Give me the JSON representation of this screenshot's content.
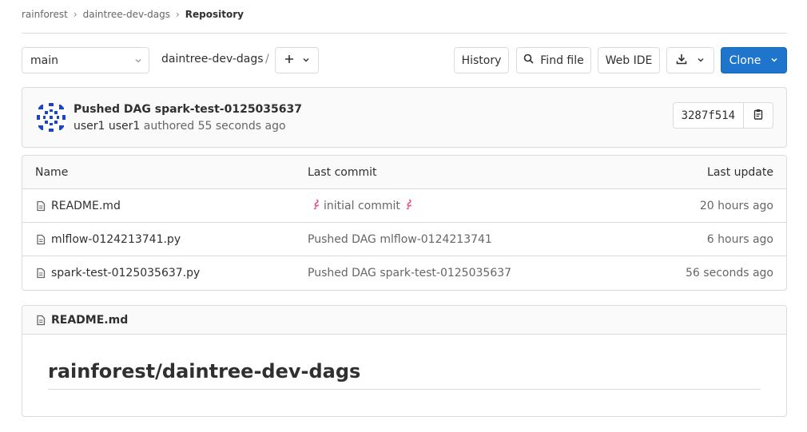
{
  "breadcrumb": {
    "items": [
      "rainforest",
      "daintree-dev-dags"
    ],
    "current": "Repository"
  },
  "toolbar": {
    "branch": "main",
    "repo_path": "daintree-dev-dags",
    "slash": "/",
    "add_icon": "plus-icon",
    "history_label": "History",
    "find_file_label": "Find file",
    "web_ide_label": "Web IDE",
    "download_icon": "download-icon",
    "clone_label": "Clone",
    "clone_color": "#1f75cb"
  },
  "commit": {
    "title": "Pushed DAG spark-test-0125035637",
    "author": "user1 user1",
    "authored_text": "authored 55 seconds ago",
    "sha": "3287f514",
    "copy_icon": "clipboard-icon"
  },
  "files": {
    "columns": [
      "Name",
      "Last commit",
      "Last update"
    ],
    "rows": [
      {
        "name": "README.md",
        "commit_prefix": "",
        "commit": "initial commit",
        "has_emoji": true,
        "updated": "20 hours ago"
      },
      {
        "name": "mlflow-0124213741.py",
        "commit": "Pushed DAG mlflow-0124213741",
        "has_emoji": false,
        "updated": "6 hours ago"
      },
      {
        "name": "spark-test-0125035637.py",
        "commit": "Pushed DAG spark-test-0125035637",
        "has_emoji": false,
        "updated": "56 seconds ago"
      }
    ]
  },
  "readme": {
    "filename": "README.md",
    "heading": "rainforest/daintree-dev-dags"
  }
}
